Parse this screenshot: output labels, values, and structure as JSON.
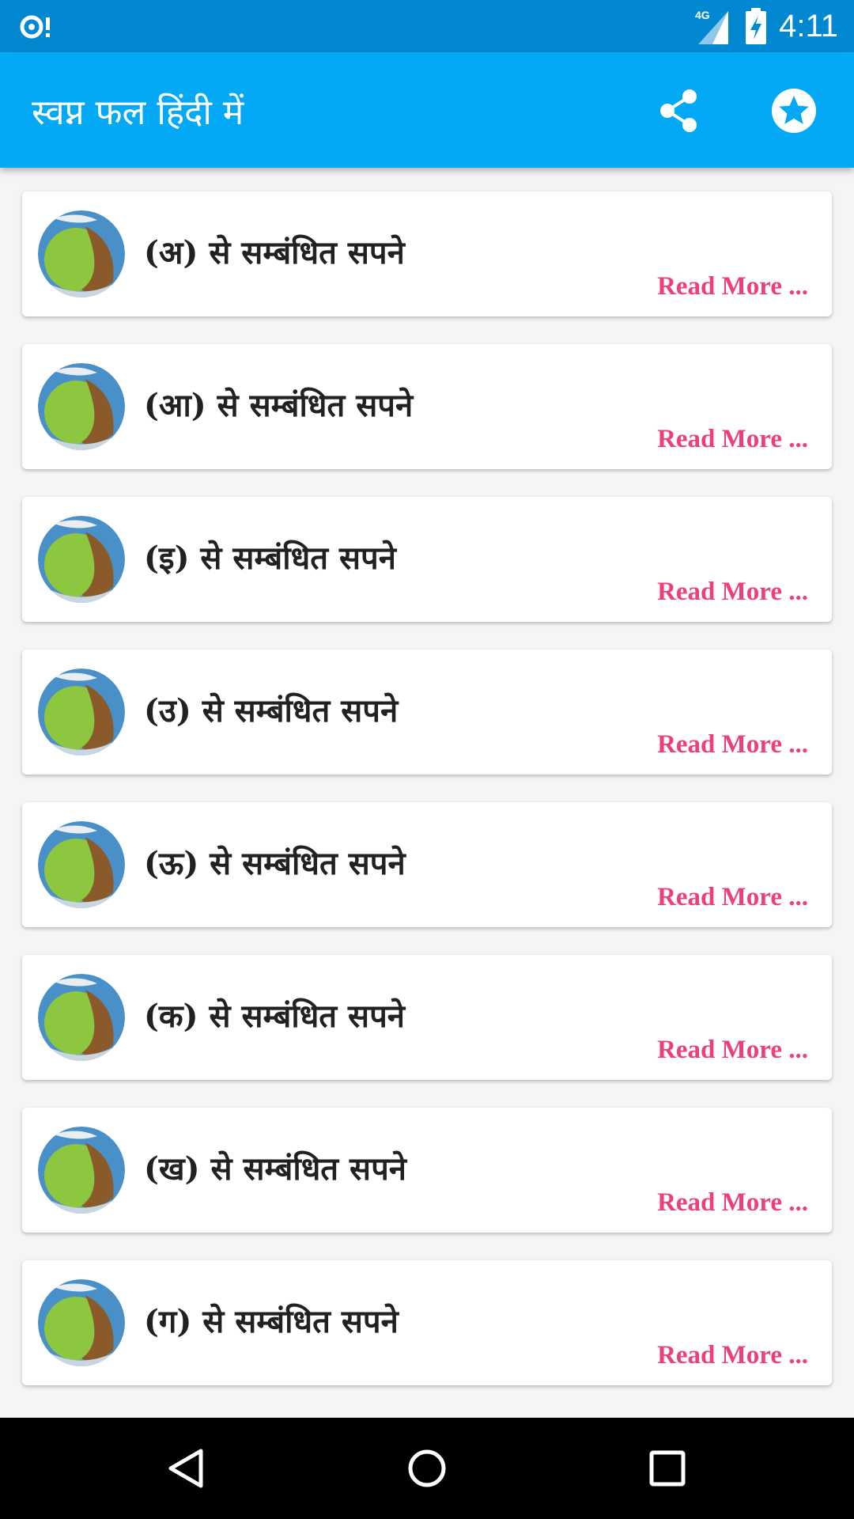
{
  "status_bar": {
    "time": "4:11",
    "network": "4G",
    "icons": [
      "sync-alert-icon",
      "cell-signal-icon",
      "battery-charging-icon"
    ]
  },
  "app_bar": {
    "title": "स्वप्न फल हिंदी में",
    "actions": [
      "share-icon",
      "star-icon"
    ]
  },
  "list": {
    "items": [
      {
        "title": "(अ) से सम्बंधित सपने",
        "more": "Read More ..."
      },
      {
        "title": "(आ) से सम्बंधित सपने",
        "more": "Read More ..."
      },
      {
        "title": "(इ) से सम्बंधित सपने",
        "more": "Read More ..."
      },
      {
        "title": "(उ) से सम्बंधित सपने",
        "more": "Read More ..."
      },
      {
        "title": "(ऊ) से सम्बंधित सपने",
        "more": "Read More ..."
      },
      {
        "title": "(क) से सम्बंधित सपने",
        "more": "Read More ..."
      },
      {
        "title": "(ख) से सम्बंधित सपने",
        "more": "Read More ..."
      },
      {
        "title": "(ग) से सम्बंधित सपने",
        "more": "Read More ..."
      }
    ]
  },
  "nav_bar": {
    "buttons": [
      "back-icon",
      "home-icon",
      "recents-icon"
    ]
  },
  "colors": {
    "status_bar": "#0288d1",
    "app_bar": "#03a9f4",
    "read_more": "#ec407a",
    "title_text": "#212121"
  }
}
